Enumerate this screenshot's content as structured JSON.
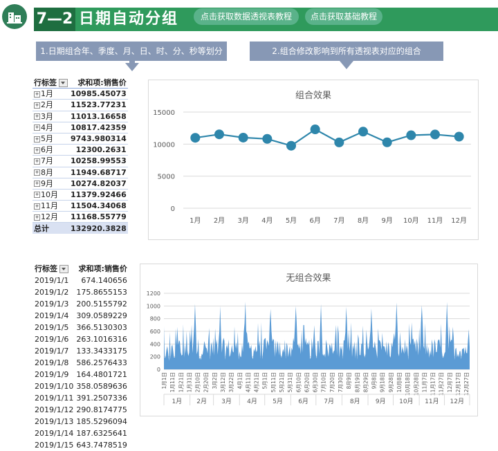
{
  "header": {
    "section_number": "7—2",
    "title": "日期自动分组",
    "button_pivot_tutorial": "点击获取数据透视表教程",
    "button_basic_tutorial": "点击获取基础教程",
    "logo_icon": "building-icon"
  },
  "callouts": {
    "left": "1.日期组合年、季度、月、日、时、分、秒等划分",
    "right": "2.组合修改影响到所有透视表对应的组合"
  },
  "pivot_grouped": {
    "col_label": "行标签",
    "col_value": "求和项:销售价",
    "rows": [
      {
        "label": "1月",
        "value": "10985.45073"
      },
      {
        "label": "2月",
        "value": "11523.77231"
      },
      {
        "label": "3月",
        "value": "11013.16658"
      },
      {
        "label": "4月",
        "value": "10817.42359"
      },
      {
        "label": "5月",
        "value": "9743.980314"
      },
      {
        "label": "6月",
        "value": "12300.2631"
      },
      {
        "label": "7月",
        "value": "10258.99553"
      },
      {
        "label": "8月",
        "value": "11949.68717"
      },
      {
        "label": "9月",
        "value": "10274.82037"
      },
      {
        "label": "10月",
        "value": "11379.92466"
      },
      {
        "label": "11月",
        "value": "11504.34068"
      },
      {
        "label": "12月",
        "value": "11168.55779"
      }
    ],
    "total_label": "总计",
    "total_value": "132920.3828"
  },
  "pivot_ungrouped": {
    "col_label": "行标签",
    "col_value": "求和项:销售价",
    "rows": [
      {
        "label": "2019/1/1",
        "value": "674.140656"
      },
      {
        "label": "2019/1/2",
        "value": "175.8655153"
      },
      {
        "label": "2019/1/3",
        "value": "200.5155792"
      },
      {
        "label": "2019/1/4",
        "value": "309.0589229"
      },
      {
        "label": "2019/1/5",
        "value": "366.5130303"
      },
      {
        "label": "2019/1/6",
        "value": "263.1016316"
      },
      {
        "label": "2019/1/7",
        "value": "133.3433175"
      },
      {
        "label": "2019/1/8",
        "value": "586.2576433"
      },
      {
        "label": "2019/1/9",
        "value": "164.4801721"
      },
      {
        "label": "2019/1/10",
        "value": "358.0589636"
      },
      {
        "label": "2019/1/11",
        "value": "391.2507336"
      },
      {
        "label": "2019/1/12",
        "value": "290.8174775"
      },
      {
        "label": "2019/1/13",
        "value": "185.5296094"
      },
      {
        "label": "2019/1/14",
        "value": "187.6325641"
      },
      {
        "label": "2019/1/15",
        "value": "643.7478519"
      }
    ]
  },
  "chart_data": [
    {
      "type": "line",
      "title": "组合效果",
      "categories": [
        "1月",
        "2月",
        "3月",
        "4月",
        "5月",
        "6月",
        "7月",
        "8月",
        "9月",
        "10月",
        "11月",
        "12月"
      ],
      "values": [
        10985.45073,
        11523.77231,
        11013.16658,
        10817.42359,
        9743.980314,
        12300.2631,
        10258.99553,
        11949.68717,
        10274.82037,
        11379.92466,
        11504.34068,
        11168.55779
      ],
      "ylim": [
        0,
        15000
      ],
      "yticks": [
        "0",
        "5000",
        "10000",
        "15000"
      ],
      "grid": true,
      "color": "#2e86ab"
    },
    {
      "type": "area",
      "title": "无组合效果",
      "ylim": [
        0,
        1200
      ],
      "yticks": [
        "0",
        "200",
        "400",
        "600",
        "800",
        "1000",
        "1200"
      ],
      "months": [
        "1月",
        "2月",
        "3月",
        "4月",
        "5月",
        "6月",
        "7月",
        "8月",
        "9月",
        "10月",
        "11月",
        "12月"
      ],
      "day_ticks": [
        "1月1日",
        "1月11日",
        "1月21日",
        "1月31日",
        "2月10日",
        "2月20日",
        "3月2日",
        "3月12日",
        "3月22日",
        "4月1日",
        "4月11日",
        "4月21日",
        "5月1日",
        "5月11日",
        "5月21日",
        "5月31日",
        "6月10日",
        "6月20日",
        "6月30日",
        "7月10日",
        "7月20日",
        "7月30日",
        "8月9日",
        "8月19日",
        "8月29日",
        "9月8日",
        "9月18日",
        "9月28日",
        "10月8日",
        "10月18日",
        "10月28日",
        "11月7日",
        "11月17日",
        "11月27日",
        "12月7日",
        "12月17日",
        "12月27日"
      ],
      "first_days_values": [
        674.140656,
        175.8655153,
        200.5155792,
        309.0589229,
        366.5130303,
        263.1016316,
        133.3433175,
        586.2576433,
        164.4801721,
        358.0589636,
        391.2507336,
        290.8174775,
        185.5296094,
        187.6325641,
        643.7478519
      ],
      "grid": true,
      "color": "#5b9bd5"
    }
  ]
}
